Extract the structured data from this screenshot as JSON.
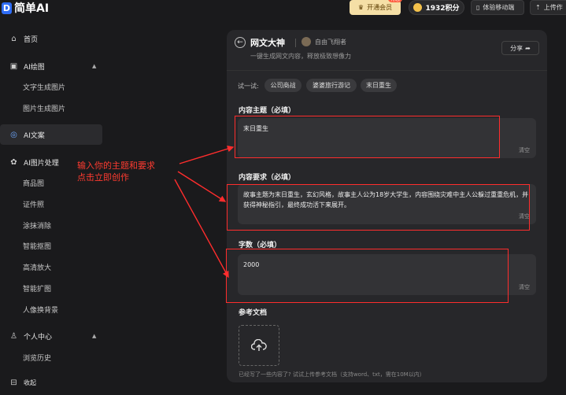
{
  "brand": {
    "logo_letter": "D",
    "name": "简单AI"
  },
  "header": {
    "vip_label": "开通会员",
    "vip_badge": "特惠",
    "points_label": "1932积分",
    "mobile_label": "体验移动端",
    "upload_label": "上传作"
  },
  "sidebar": {
    "items": [
      {
        "label": "首页"
      },
      {
        "label": "AI绘图"
      },
      {
        "label": "文字生成图片"
      },
      {
        "label": "图片生成图片"
      },
      {
        "label": "AI文案"
      },
      {
        "label": "AI图片处理"
      },
      {
        "label": "商品图"
      },
      {
        "label": "证件照"
      },
      {
        "label": "涂抹消除"
      },
      {
        "label": "智能抠图"
      },
      {
        "label": "高清放大"
      },
      {
        "label": "智能扩图"
      },
      {
        "label": "人像换背景"
      },
      {
        "label": "个人中心"
      },
      {
        "label": "浏览历史"
      },
      {
        "label": "收起"
      }
    ]
  },
  "annotation": {
    "line1": "输入你的主题和要求",
    "line2": "点击立即创作"
  },
  "panel": {
    "title": "网文大神",
    "author": "自由飞翔者",
    "subtitle": "一键生成网文内容，释放极致想像力",
    "share_label": "分享",
    "try_label": "试一试:",
    "chips": [
      "公司商战",
      "婆婆旅行游记",
      "末日重生"
    ],
    "fields": [
      {
        "label": "内容主题（必填）",
        "value": "末日重生",
        "clear": "清空"
      },
      {
        "label": "内容要求（必填）",
        "value": "故事主题为末日重生，玄幻风格，故事主人公为18岁大学生，内容围绕灾难中主人公躲过重重危机，并获得神秘指引，最终成功活下来展开。",
        "clear": "清空"
      },
      {
        "label": "字数（必填）",
        "value": "2000",
        "clear": "清空"
      }
    ],
    "ref_label": "参考文档",
    "upload_hint": "已经写了一些内容了? 试试上传参考文档（支持word、txt，需在10M以内）"
  }
}
